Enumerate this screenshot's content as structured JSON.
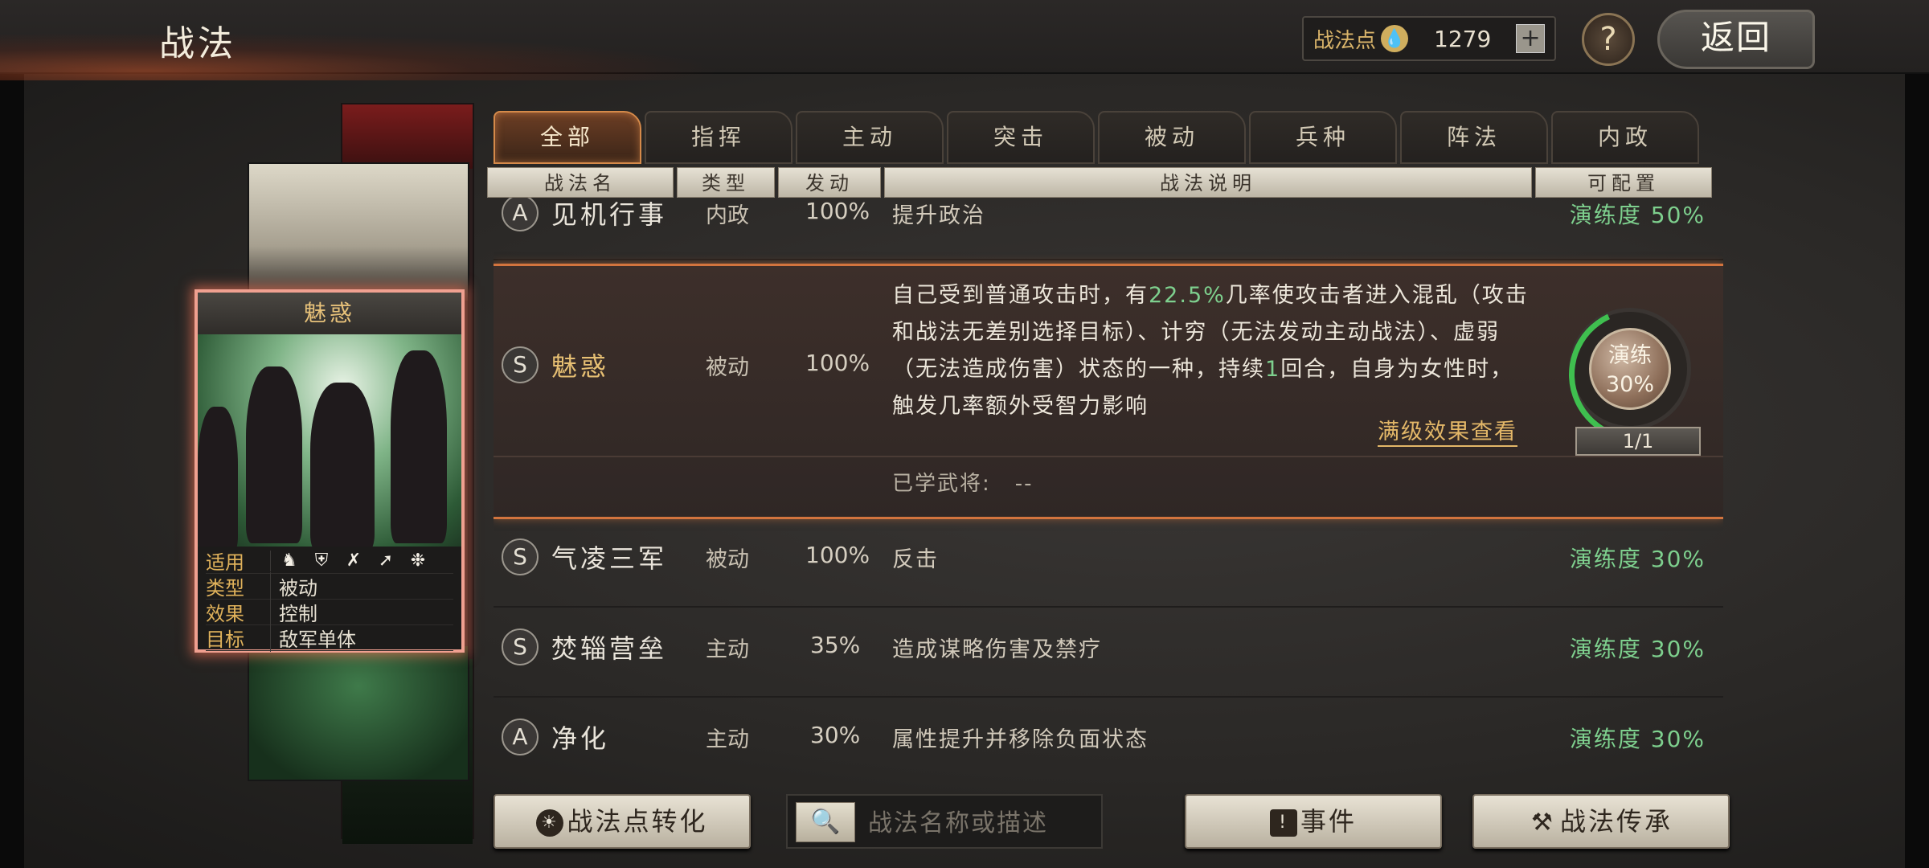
{
  "header": {
    "title": "战法",
    "points_label": "战法点",
    "points_value": "1279",
    "plus_label": "+",
    "help_label": "?",
    "back_label": "返回"
  },
  "hero_card": {
    "name": "魅惑",
    "info": [
      {
        "key": "适用",
        "value": ""
      },
      {
        "key": "类型",
        "value": "被动"
      },
      {
        "key": "效果",
        "value": "控制"
      },
      {
        "key": "目标",
        "value": "敌军单体"
      }
    ],
    "unit_icons": [
      "cavalry-icon",
      "shield-icon",
      "bow-icon",
      "spear-icon",
      "wheel-icon"
    ]
  },
  "tabs": [
    {
      "label": "全部",
      "active": true
    },
    {
      "label": "指挥"
    },
    {
      "label": "主动"
    },
    {
      "label": "突击"
    },
    {
      "label": "被动"
    },
    {
      "label": "兵种"
    },
    {
      "label": "阵法"
    },
    {
      "label": "内政"
    }
  ],
  "columns": [
    "战法名",
    "类型",
    "发动",
    "战法说明",
    "可配置"
  ],
  "rows": [
    {
      "grade": "A",
      "name": "见机行事",
      "type": "内政",
      "rate": "100%",
      "desc": "提升政治",
      "level": "演练度 50%"
    },
    {
      "grade": "S",
      "name": "魅惑",
      "type": "被动",
      "rate": "100%",
      "desc_parts": [
        "自己受到普通攻击时，有",
        "22.5%",
        "几率使攻击者进入混乱（攻击和战法无差别选择目标）、计穷（无法发动主动战法）、虚弱（无法造成伤害）状态的一种，持续",
        "1",
        "回合，自身为女性时，触发几率额外受智力影响"
      ],
      "full_effect_label": "满级效果查看",
      "learned_label": "已学武将:",
      "learned_value": "--",
      "ring_label": "演练",
      "ring_value": "30%",
      "plate_value": "1/1"
    },
    {
      "grade": "S",
      "name": "气凌三军",
      "type": "被动",
      "rate": "100%",
      "desc": "反击",
      "level": "演练度 30%"
    },
    {
      "grade": "S",
      "name": "焚辎营垒",
      "type": "主动",
      "rate": "35%",
      "desc": "造成谋略伤害及禁疗",
      "level": "演练度 30%"
    },
    {
      "grade": "A",
      "name": "净化",
      "type": "主动",
      "rate": "30%",
      "desc": "属性提升并移除负面状态",
      "level": "演练度 30%"
    }
  ],
  "bottom": {
    "convert_label": "战法点转化",
    "search_placeholder": "战法名称或描述",
    "events_label": "事件",
    "inherit_label": "战法传承"
  },
  "colors": {
    "accent": "#d2743e",
    "green": "#7ed08e",
    "gold": "#e3b768"
  }
}
